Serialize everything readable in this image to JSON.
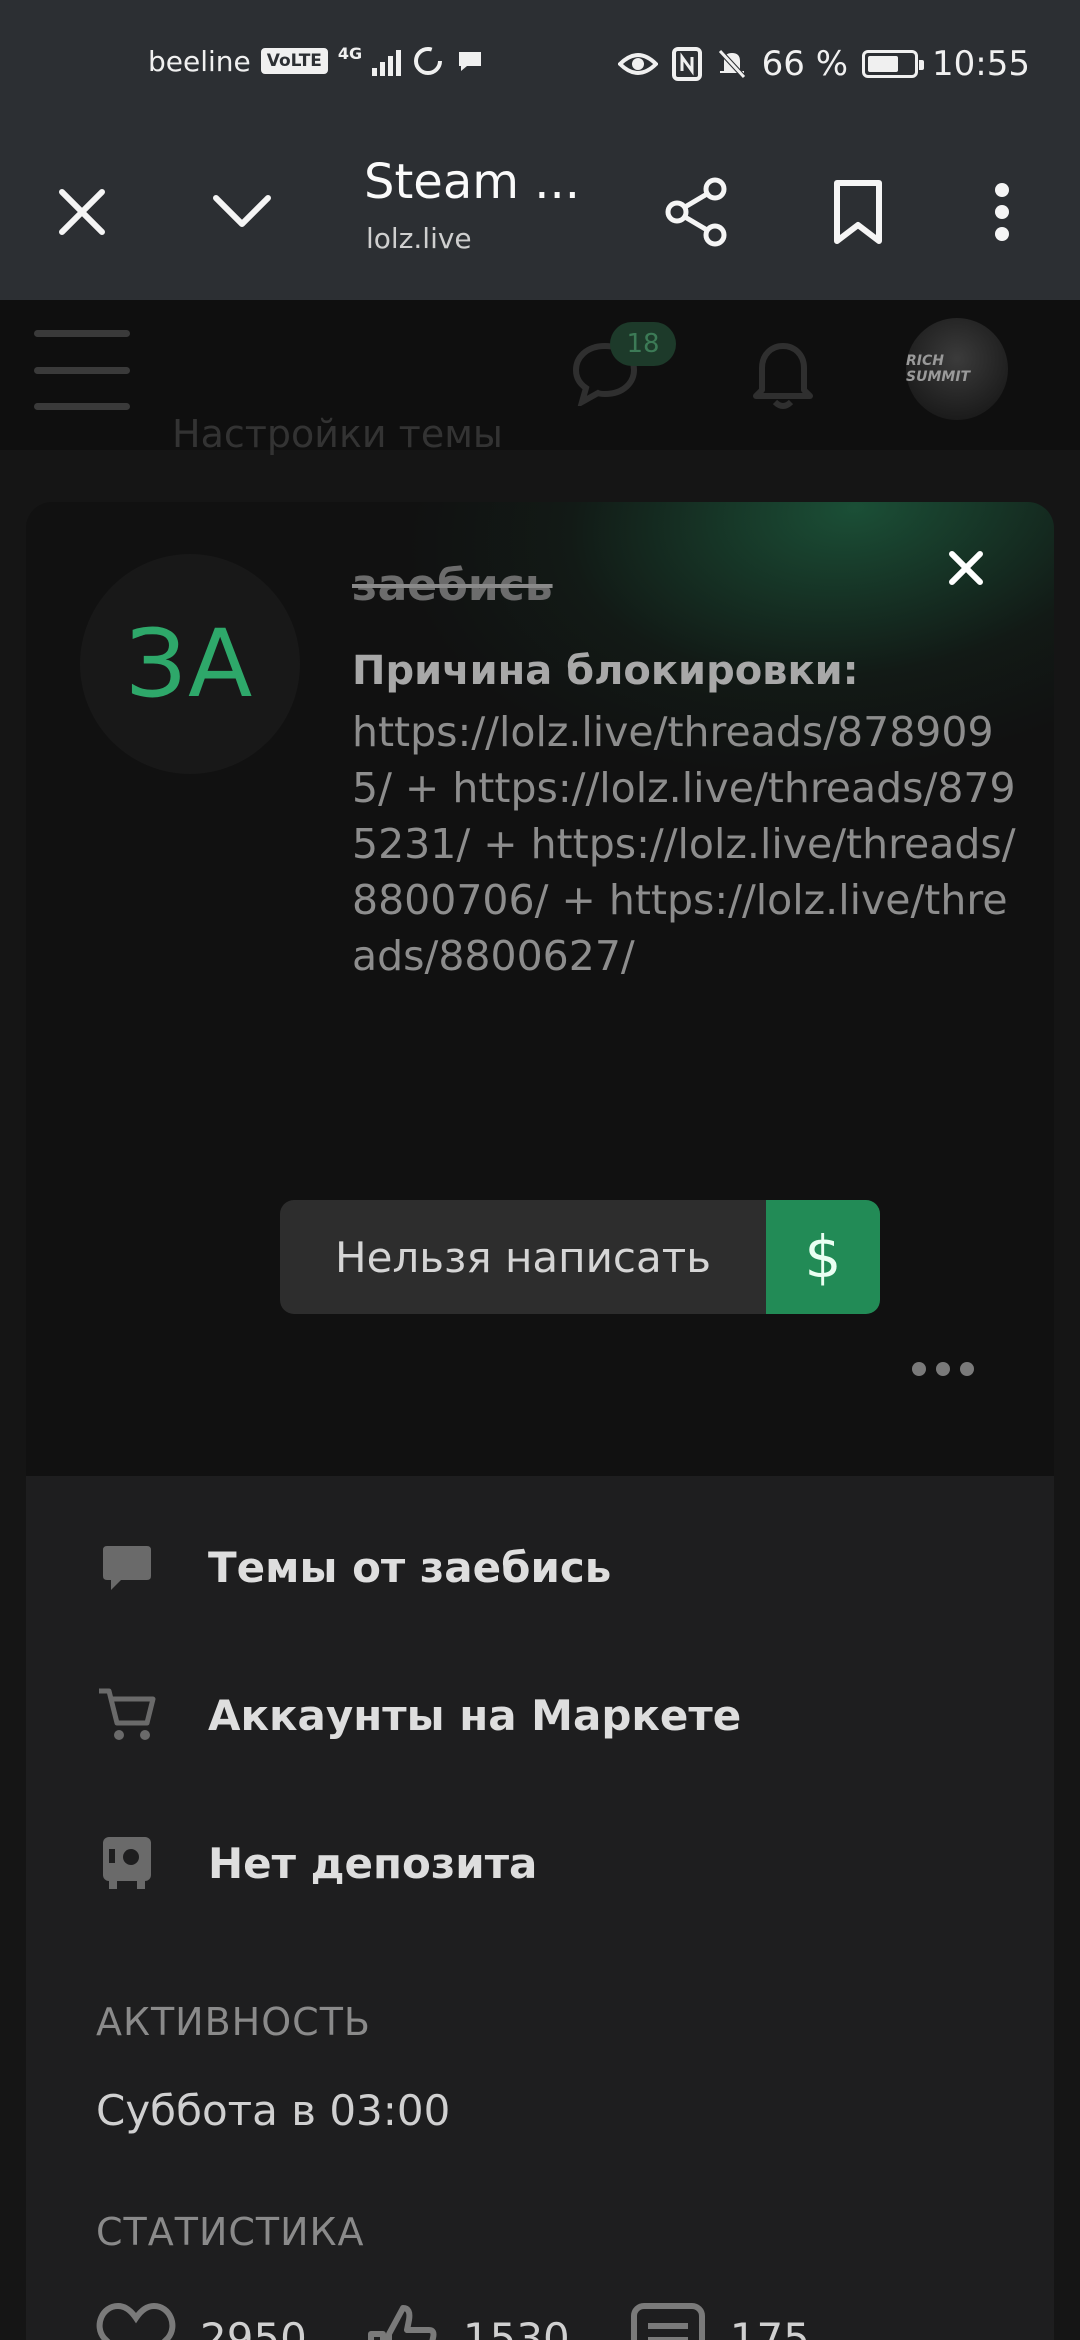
{
  "status_bar": {
    "carrier": "beeline",
    "volte": "VoLTE",
    "network": "4G",
    "battery": "66 %",
    "time": "10:55"
  },
  "browser": {
    "title": "Steam ...",
    "url": "lolz.live"
  },
  "site_header": {
    "messages_count": "18",
    "avatar_text": "RICH SUMMIT",
    "behind_text": "Настройки темы"
  },
  "profile": {
    "avatar_initials": "ЗА",
    "username": "заебись",
    "ban_label": "Причина блокировки:",
    "ban_reason": "https://lolz.live/threads/8789095/ + https://lolz.live/threads/8795231/ + https://lolz.live/threads/8800706/ + https://lolz.live/threads/8800627/",
    "write_label": "Нельзя написать",
    "money_label": "$"
  },
  "links": [
    {
      "label": "Темы от заебись",
      "icon": "chat-bubble-icon"
    },
    {
      "label": "Аккаунты на Маркете",
      "icon": "cart-icon"
    },
    {
      "label": "Нет депозита",
      "icon": "safe-icon"
    }
  ],
  "activity": {
    "title": "АКТИВНОСТЬ",
    "value": "Суббота в 03:00"
  },
  "stats": {
    "title": "СТАТИСТИКА",
    "likes": "2950",
    "reactions": "1530",
    "posts": "175"
  }
}
